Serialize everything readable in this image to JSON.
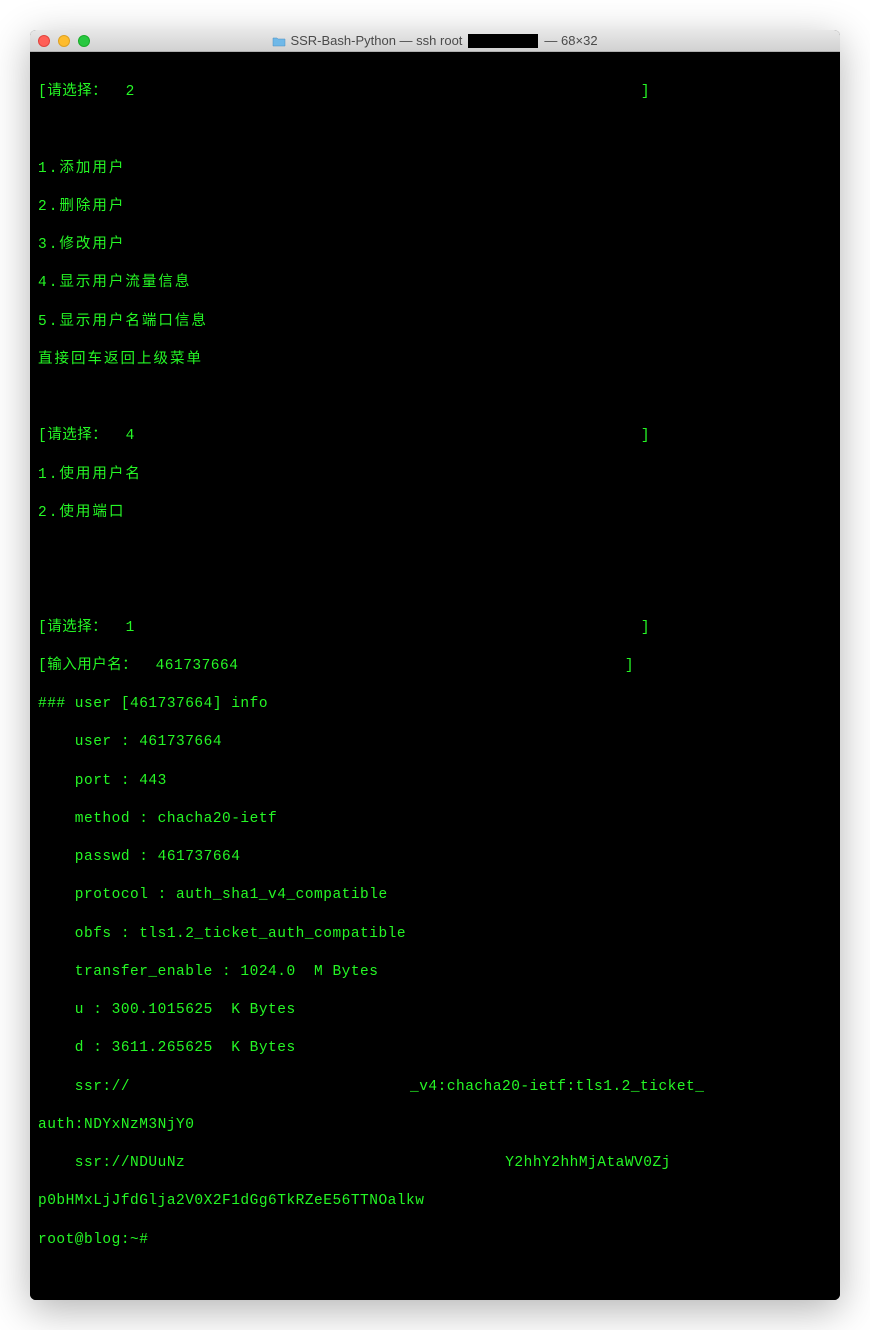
{
  "window": {
    "title_prefix": "SSR-Bash-Python — ssh root",
    "title_suffix": " — 68×32"
  },
  "lines": {
    "prompt1": "[请选择：  2                                                       ]",
    "menu1_1": "1.添加用户",
    "menu1_2": "2.删除用户",
    "menu1_3": "3.修改用户",
    "menu1_4": "4.显示用户流量信息",
    "menu1_5": "5.显示用户名端口信息",
    "menu1_6": "直接回车返回上级菜单",
    "prompt2": "[请选择：  4                                                       ]",
    "menu2_1": "1.使用用户名",
    "menu2_2": "2.使用端口",
    "prompt3": "[请选择：  1                                                       ]",
    "input_user": "[输入用户名：  461737664                                          ]",
    "info_header": "### user [461737664] info",
    "info_user": "    user : 461737664",
    "info_port": "    port : 443",
    "info_method": "    method : chacha20-ietf",
    "info_passwd": "    passwd : 461737664",
    "info_protocol": "    protocol : auth_sha1_v4_compatible",
    "info_obfs": "    obfs : tls1.2_ticket_auth_compatible",
    "info_transfer": "    transfer_enable : 1024.0  M Bytes",
    "info_u": "    u : 300.1015625  K Bytes",
    "info_d": "    d : 3611.265625  K Bytes",
    "info_ssr1_a": "    ssr://",
    "info_ssr1_b": "_v4:chacha20-ietf:tls1.2_ticket_",
    "info_ssr1_c": "auth:NDYxNzM3NjY0",
    "info_ssr2_a": "    ssr://NDUuNz",
    "info_ssr2_b": "Y2hhY2hhMjAtaWV0Zj",
    "info_ssr2_c": "p0bHMxLjJfdGlja2V0X2F1dGg6TkRZeE56TTNOalkw",
    "shell_prompt": "root@blog:~#"
  }
}
